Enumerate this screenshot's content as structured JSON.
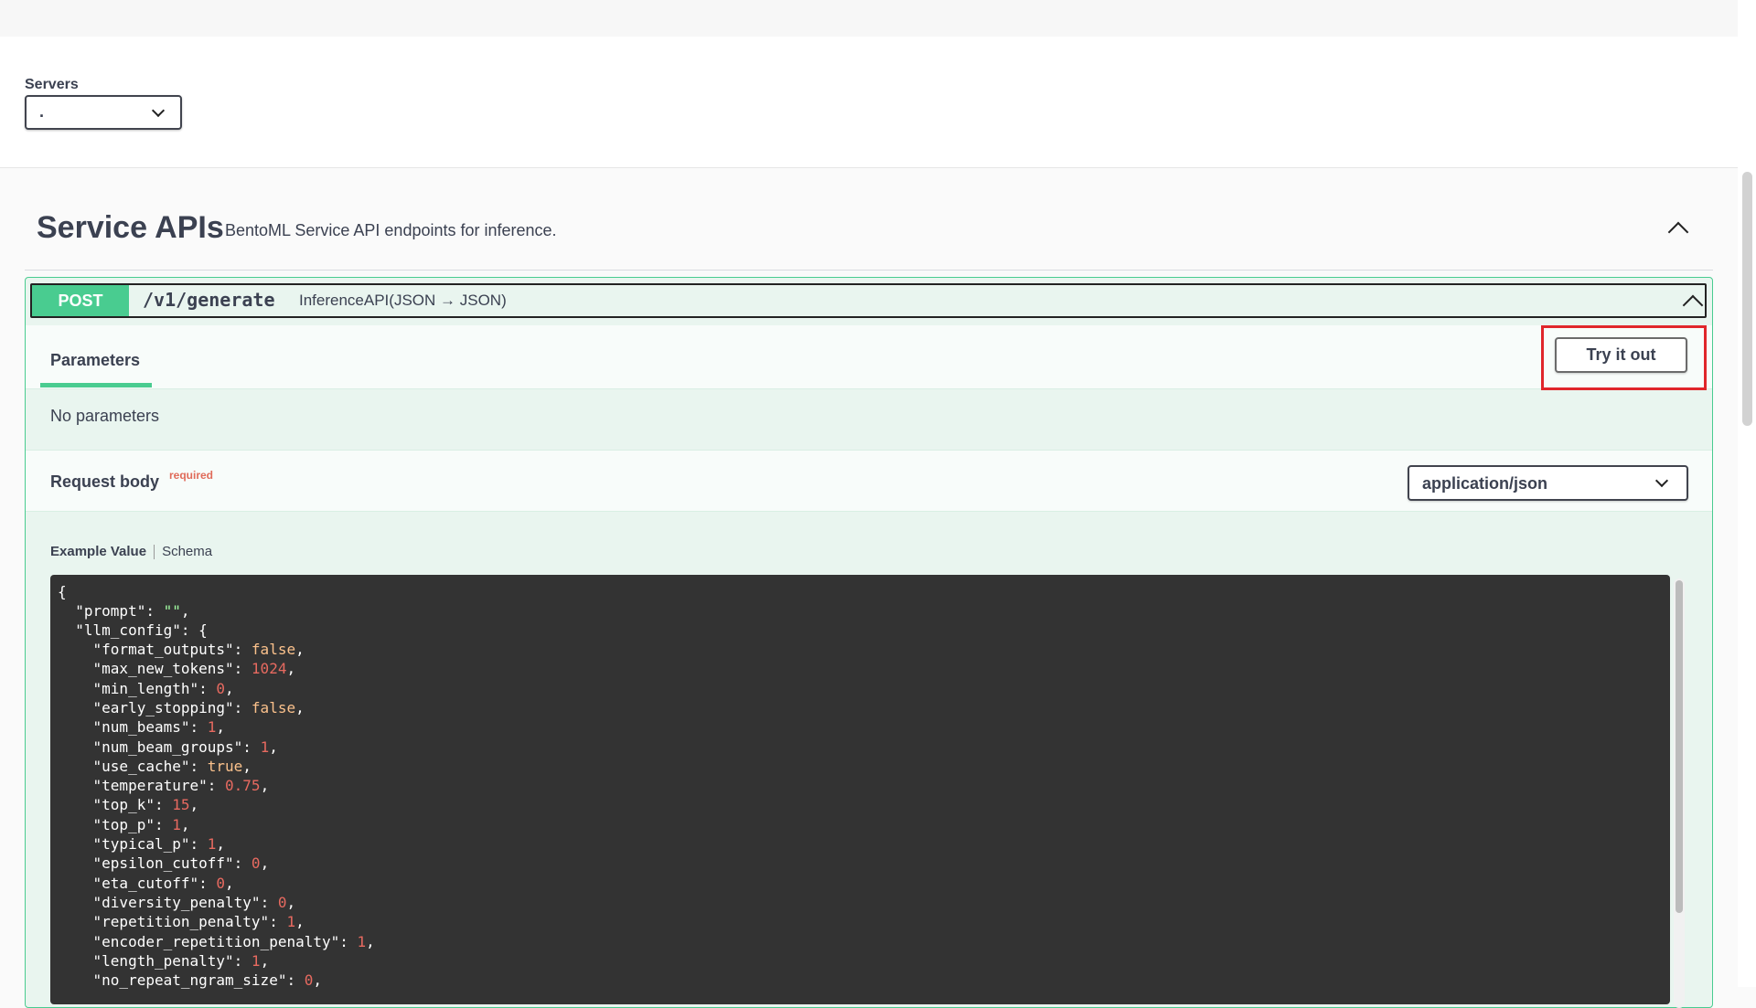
{
  "servers": {
    "label": "Servers",
    "selected": "."
  },
  "tag": {
    "title": "Service APIs",
    "description": "BentoML Service API endpoints for inference."
  },
  "operation": {
    "method": "POST",
    "path": "/v1/generate",
    "summary": "InferenceAPI(JSON → JSON)",
    "parameters_tab": "Parameters",
    "try_button": "Try it out",
    "no_parameters": "No parameters",
    "request_body_label": "Request body",
    "required_label": "required",
    "content_type": "application/json",
    "example_tab": "Example Value",
    "schema_tab": "Schema"
  },
  "example_json": {
    "open_brace": "{",
    "prompt_key": "\"prompt\"",
    "prompt_value": "\"\"",
    "llm_config_key": "\"llm_config\"",
    "config": [
      {
        "key": "\"format_outputs\"",
        "value": "false",
        "kind": "bool"
      },
      {
        "key": "\"max_new_tokens\"",
        "value": "1024",
        "kind": "num"
      },
      {
        "key": "\"min_length\"",
        "value": "0",
        "kind": "num"
      },
      {
        "key": "\"early_stopping\"",
        "value": "false",
        "kind": "bool"
      },
      {
        "key": "\"num_beams\"",
        "value": "1",
        "kind": "num"
      },
      {
        "key": "\"num_beam_groups\"",
        "value": "1",
        "kind": "num"
      },
      {
        "key": "\"use_cache\"",
        "value": "true",
        "kind": "bool"
      },
      {
        "key": "\"temperature\"",
        "value": "0.75",
        "kind": "num"
      },
      {
        "key": "\"top_k\"",
        "value": "15",
        "kind": "num"
      },
      {
        "key": "\"top_p\"",
        "value": "1",
        "kind": "num"
      },
      {
        "key": "\"typical_p\"",
        "value": "1",
        "kind": "num"
      },
      {
        "key": "\"epsilon_cutoff\"",
        "value": "0",
        "kind": "num"
      },
      {
        "key": "\"eta_cutoff\"",
        "value": "0",
        "kind": "num"
      },
      {
        "key": "\"diversity_penalty\"",
        "value": "0",
        "kind": "num"
      },
      {
        "key": "\"repetition_penalty\"",
        "value": "1",
        "kind": "num"
      },
      {
        "key": "\"encoder_repetition_penalty\"",
        "value": "1",
        "kind": "num"
      },
      {
        "key": "\"length_penalty\"",
        "value": "1",
        "kind": "num"
      },
      {
        "key": "\"no_repeat_ngram_size\"",
        "value": "0",
        "kind": "num"
      }
    ]
  },
  "colors": {
    "post_accent": "#49cc90",
    "highlight_border": "#e0262b",
    "code_background": "#333333"
  }
}
